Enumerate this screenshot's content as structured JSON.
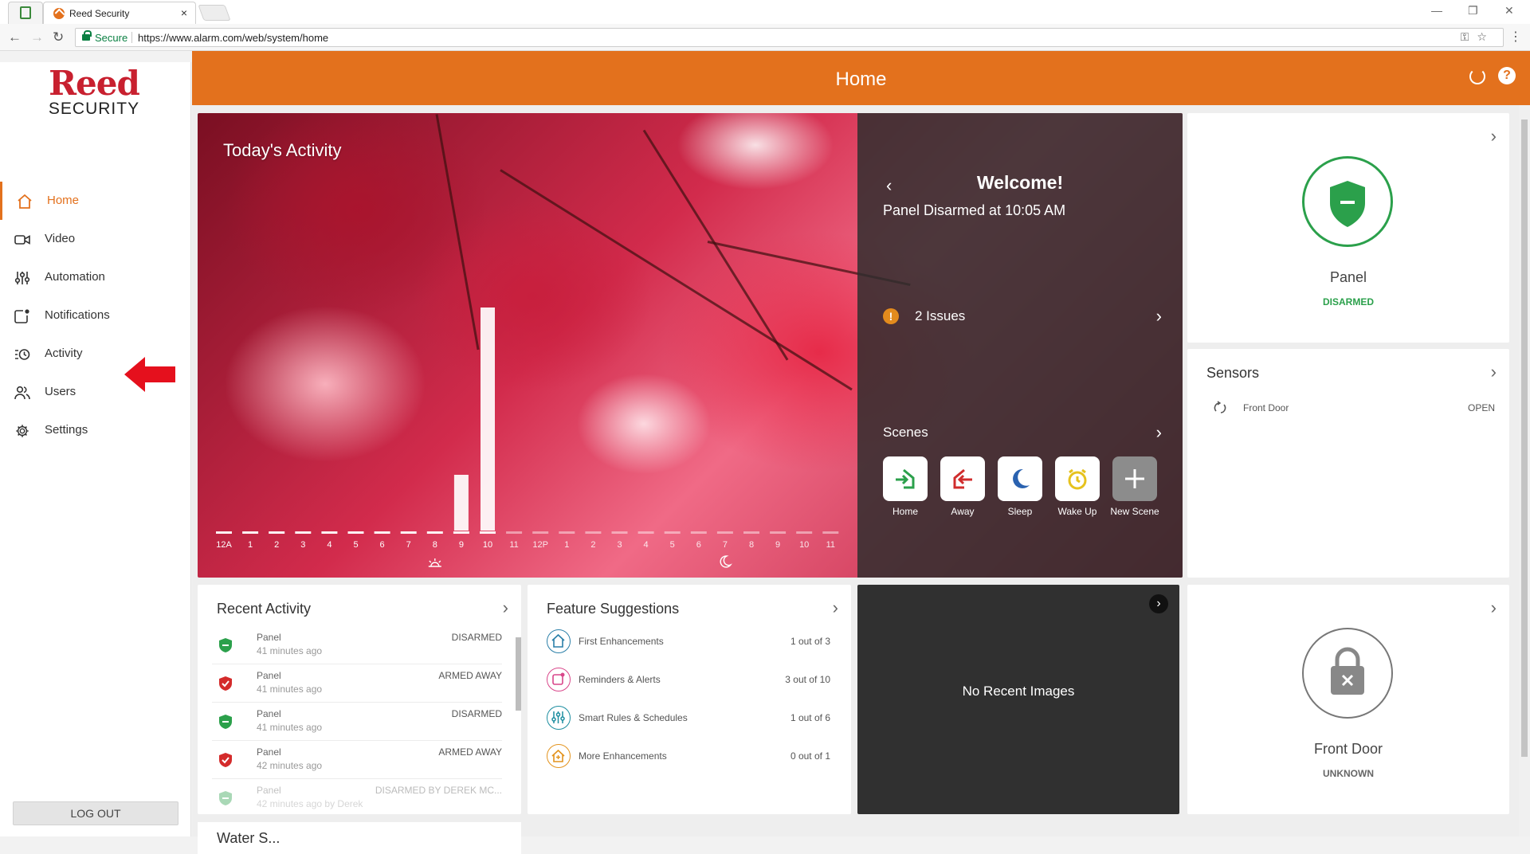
{
  "browser": {
    "tab_title": "Reed Security",
    "tab_close": "×",
    "secure_label": "Secure",
    "url": "https://www.alarm.com/web/system/home",
    "window_controls": [
      "—",
      "❐",
      "✕"
    ]
  },
  "brand": {
    "name_top": "Reed",
    "name_bottom": "SECURITY"
  },
  "sidebar": {
    "items": [
      {
        "label": "Home",
        "icon": "home-icon",
        "active": true
      },
      {
        "label": "Video",
        "icon": "video-camera-icon"
      },
      {
        "label": "Automation",
        "icon": "sliders-icon"
      },
      {
        "label": "Notifications",
        "icon": "notification-icon"
      },
      {
        "label": "Activity",
        "icon": "activity-icon"
      },
      {
        "label": "Users",
        "icon": "users-icon"
      },
      {
        "label": "Settings",
        "icon": "gear-icon"
      }
    ],
    "logout_label": "LOG OUT"
  },
  "header": {
    "title": "Home"
  },
  "hero": {
    "title": "Today's Activity",
    "welcome": "Welcome!",
    "status": "Panel Disarmed at 10:05 AM",
    "issues_label": "2 Issues",
    "scenes_label": "Scenes",
    "scenes": [
      {
        "label": "Home",
        "icon": "home-arrive-icon"
      },
      {
        "label": "Away",
        "icon": "away-leave-icon"
      },
      {
        "label": "Sleep",
        "icon": "moon-icon"
      },
      {
        "label": "Wake Up",
        "icon": "alarm-clock-icon"
      },
      {
        "label": "New Scene",
        "icon": "plus-icon"
      }
    ]
  },
  "chart_data": {
    "type": "bar",
    "title": "Today's Activity",
    "categories": [
      "12A",
      "1",
      "2",
      "3",
      "4",
      "5",
      "6",
      "7",
      "8",
      "9",
      "10",
      "11",
      "12P",
      "1",
      "2",
      "3",
      "4",
      "5",
      "6",
      "7",
      "8",
      "9",
      "10",
      "11"
    ],
    "values": [
      0,
      0,
      0,
      0,
      0,
      0,
      0,
      0,
      0,
      1,
      4,
      0,
      0,
      0,
      0,
      0,
      0,
      0,
      0,
      0,
      0,
      0,
      0,
      0
    ],
    "elapsed_hours": 11,
    "markers": [
      "sunrise-icon",
      "moon-icon"
    ],
    "colors": {
      "elapsed": "#ffffff",
      "future": "#ffffff"
    }
  },
  "panel_card": {
    "name": "Panel",
    "state": "DISARMED",
    "color": "#2ba04b"
  },
  "sensors_card": {
    "title": "Sensors",
    "items": [
      {
        "name": "Front Door",
        "state": "OPEN"
      }
    ]
  },
  "recent_activity": {
    "title": "Recent Activity",
    "items": [
      {
        "device": "Panel",
        "time": "41 minutes ago",
        "event": "DISARMED",
        "status": "green"
      },
      {
        "device": "Panel",
        "time": "41 minutes ago",
        "event": "ARMED AWAY",
        "status": "red"
      },
      {
        "device": "Panel",
        "time": "41 minutes ago",
        "event": "DISARMED",
        "status": "green"
      },
      {
        "device": "Panel",
        "time": "42 minutes ago",
        "event": "ARMED AWAY",
        "status": "red"
      },
      {
        "device": "Panel",
        "time": "42 minutes ago by Derek",
        "event": "DISARMED BY DEREK MC...",
        "status": "green"
      }
    ]
  },
  "feature_suggestions": {
    "title": "Feature Suggestions",
    "items": [
      {
        "name": "First Enhancements",
        "count": "1 out of 3",
        "color": "#2a7fa8"
      },
      {
        "name": "Reminders & Alerts",
        "count": "3 out of 10",
        "color": "#d9468a"
      },
      {
        "name": "Smart Rules & Schedules",
        "count": "1 out of 6",
        "color": "#1d8ea0"
      },
      {
        "name": "More Enhancements",
        "count": "0 out of 1",
        "color": "#e3931d"
      }
    ]
  },
  "images_card": {
    "empty_text": "No Recent Images"
  },
  "lock_card": {
    "name": "Front Door",
    "state": "UNKNOWN"
  },
  "water_card": {
    "title": "Water S..."
  }
}
